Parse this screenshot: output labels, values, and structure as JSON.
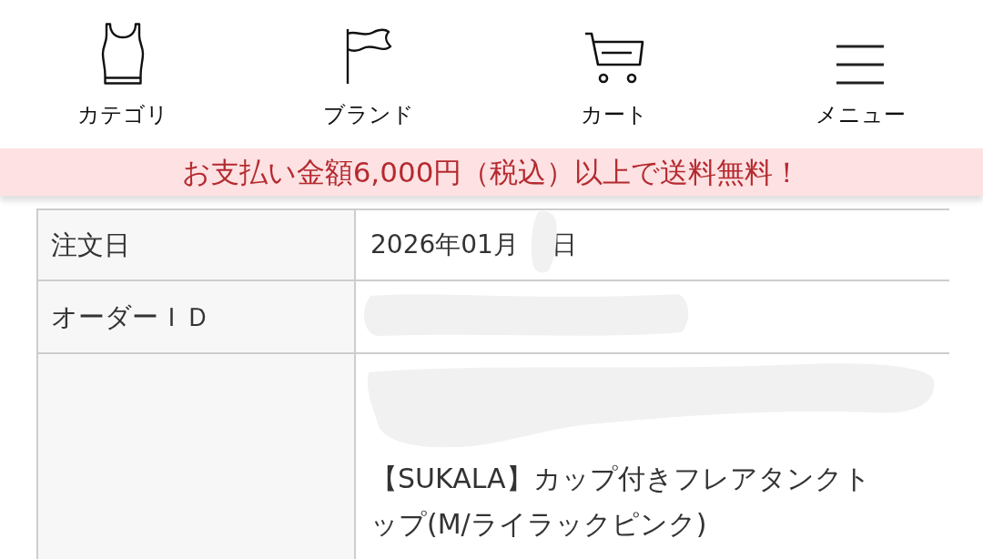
{
  "nav": [
    {
      "kind": "category",
      "label": "カテゴリ"
    },
    {
      "kind": "brand",
      "label": "ブランド"
    },
    {
      "kind": "cart",
      "label": "カート"
    },
    {
      "kind": "menu",
      "label": "メニュー"
    }
  ],
  "banner": {
    "text": "お支払い金額6,000円（税込）以上で送料無料！"
  },
  "order_table": {
    "rows": [
      {
        "kind": "date",
        "label": "注文日",
        "value_parts": [
          "2026年01月",
          "日"
        ],
        "redacted": true
      },
      {
        "kind": "id",
        "label": "オーダーＩＤ",
        "redacted": true
      },
      {
        "kind": "product",
        "value": "【SUKALA】カップ付きフレアタンクトップ(M/ライラックピンク)",
        "redacted": true
      }
    ]
  }
}
